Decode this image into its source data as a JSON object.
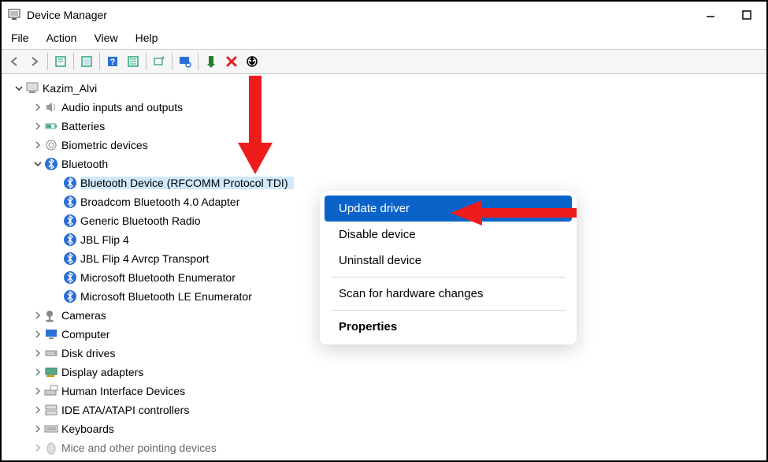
{
  "window": {
    "title": "Device Manager"
  },
  "menu": {
    "file": "File",
    "action": "Action",
    "view": "View",
    "help": "Help"
  },
  "tree": {
    "root": {
      "label": "Kazim_Alvi"
    },
    "categories": [
      {
        "label": "Audio inputs and outputs",
        "expanded": false
      },
      {
        "label": "Batteries",
        "expanded": false
      },
      {
        "label": "Biometric devices",
        "expanded": false
      },
      {
        "label": "Bluetooth",
        "expanded": true,
        "children": [
          "Bluetooth Device (RFCOMM Protocol TDI)",
          "Broadcom Bluetooth 4.0 Adapter",
          "Generic Bluetooth Radio",
          "JBL Flip 4",
          "JBL Flip 4 Avrcp Transport",
          "Microsoft Bluetooth Enumerator",
          "Microsoft Bluetooth LE Enumerator"
        ],
        "selected_index": 0
      },
      {
        "label": "Cameras",
        "expanded": false
      },
      {
        "label": "Computer",
        "expanded": false
      },
      {
        "label": "Disk drives",
        "expanded": false
      },
      {
        "label": "Display adapters",
        "expanded": false
      },
      {
        "label": "Human Interface Devices",
        "expanded": false
      },
      {
        "label": "IDE ATA/ATAPI controllers",
        "expanded": false
      },
      {
        "label": "Keyboards",
        "expanded": false
      },
      {
        "label": "Mice and other pointing devices",
        "expanded": false
      }
    ]
  },
  "context_menu": {
    "update": "Update driver",
    "disable": "Disable device",
    "uninstall": "Uninstall device",
    "scan": "Scan for hardware changes",
    "properties": "Properties"
  }
}
